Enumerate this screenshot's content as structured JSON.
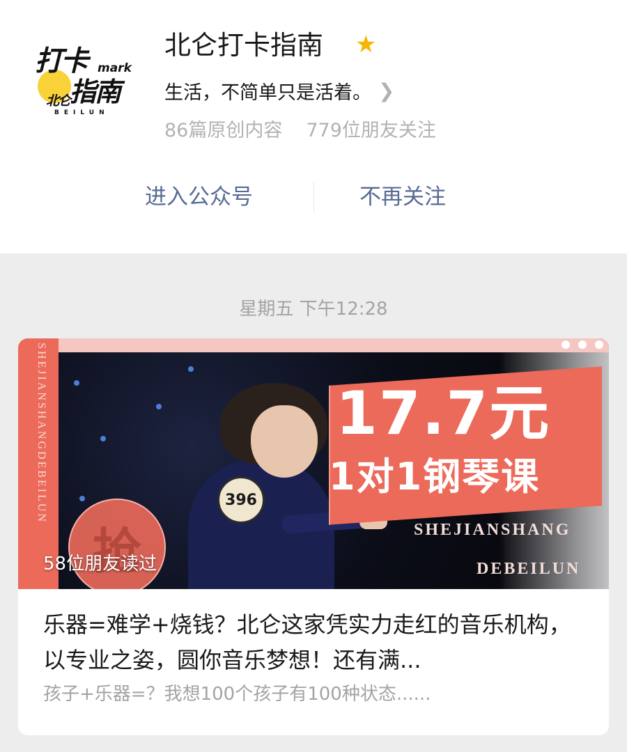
{
  "account": {
    "logo": {
      "line1": "打卡",
      "mark": "mark",
      "line2": "指南",
      "prefix": "北仑",
      "subtext": "BEILUN"
    },
    "name": "北仑打卡指南",
    "star_icon": "star-icon",
    "star_color": "#f7b500",
    "description": "生活，不简单只是活着。",
    "stats": {
      "original_count": "86篇原创内容",
      "followers": "779位朋友关注"
    }
  },
  "actions": {
    "enter_label": "进入公众号",
    "unfollow_label": "不再关注",
    "link_color": "#576b95"
  },
  "feed": {
    "timestamp": "星期五 下午12:28",
    "article": {
      "cover": {
        "vertical_text": "SHEJIANSHANGDEBEILUN",
        "price": "17.7元",
        "course": "1对1钢琴课",
        "en_line1": "SHEJIANSHANG",
        "en_line2": "DEBEILUN",
        "stamp": "抢",
        "badge_number": "396",
        "accent_color": "#ec6a5a"
      },
      "readers": "58位朋友读过",
      "title": "乐器=难学+烧钱？北仑这家凭实力走红的音乐机构，以专业之姿，圆你音乐梦想！还有满...",
      "summary": "孩子+乐器=？我想100个孩子有100种状态......"
    }
  }
}
